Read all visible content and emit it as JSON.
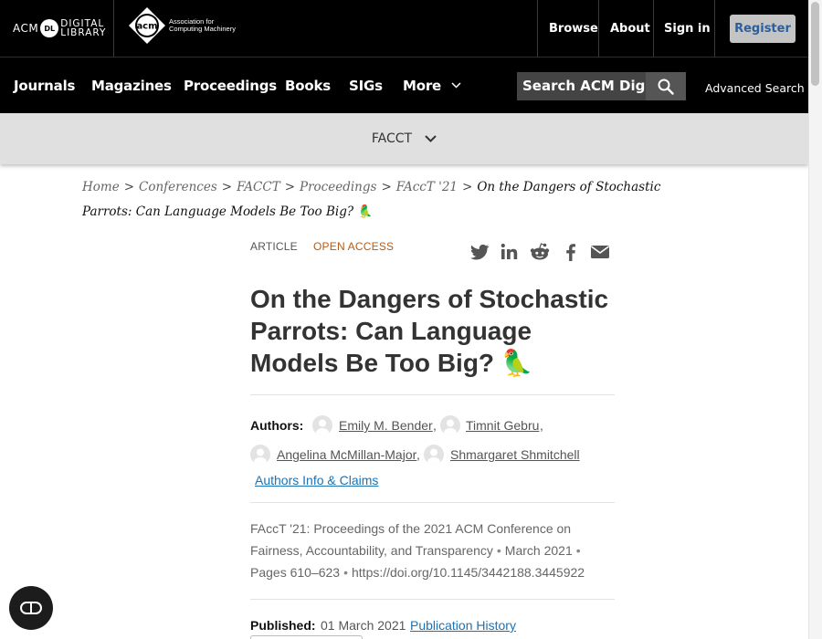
{
  "header": {
    "dl_logo": {
      "acm": "ACM",
      "badge": "DL",
      "line1": "DIGITAL",
      "line2": "LIBRARY"
    },
    "acm_logo": {
      "mark": "acm",
      "line1": "Association for",
      "line2": "Computing Machinery"
    },
    "links": {
      "browse": "Browse",
      "about": "About",
      "sign_in": "Sign in"
    },
    "register": "Register"
  },
  "nav": {
    "items": [
      "Journals",
      "Magazines",
      "Proceedings",
      "Books",
      "SIGs",
      "More"
    ],
    "search_placeholder": "Search ACM Digital Library",
    "advanced_search": "Advanced Search"
  },
  "conference_bar": {
    "label": "FACCT"
  },
  "breadcrumb": {
    "items": [
      "Home",
      "Conferences",
      "FACCT",
      "Proceedings",
      "FAccT '21"
    ],
    "current": "On the Dangers of Stochastic Parrots: Can Language Models Be Too Big? 🦜",
    "separator": ">"
  },
  "article": {
    "type": "ARTICLE",
    "access": "OPEN ACCESS",
    "share_icons": [
      "twitter-icon",
      "linkedin-icon",
      "reddit-icon",
      "facebook-icon",
      "email-icon"
    ],
    "title": "On the Dangers of Stochastic Parrots: Can Language Models Be Too Big? 🦜",
    "authors_label": "Authors:",
    "authors": [
      "Emily M. Bender",
      "Timnit Gebru",
      "Angelina McMillan-Major",
      "Shmargaret Shmitchell"
    ],
    "authors_info": "Authors Info & Claims",
    "venue": "FAccT '21: Proceedings of the 2021 ACM Conference on Fairness, Accountability, and Transparency",
    "date": "March 2021",
    "pages": "Pages 610–623",
    "doi": "https://doi.org/10.1145/3442188.3445922",
    "published_label": "Published:",
    "published_date": "01 March 2021",
    "publication_history": "Publication History"
  },
  "colors": {
    "header_bg": "#000000",
    "conf_bar_bg": "#e0e0e0",
    "open_access": "#b65b16",
    "link_blue": "#1a73b8",
    "register_bg": "#c4c4c4",
    "register_text": "#2b5e9d"
  }
}
